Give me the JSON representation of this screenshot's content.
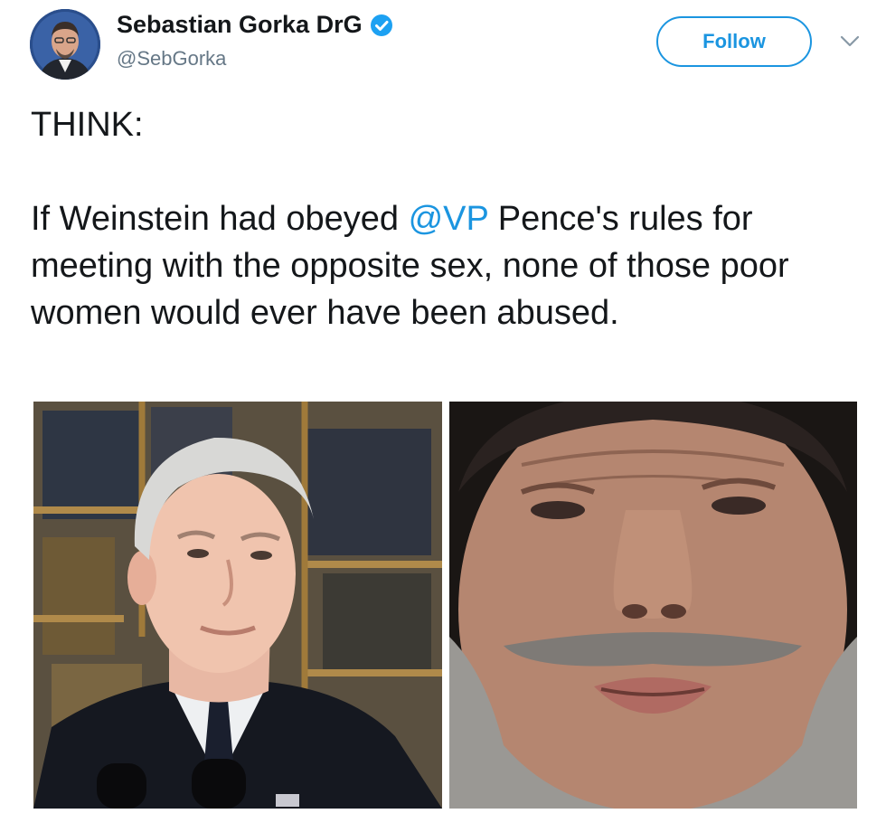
{
  "author": {
    "display_name": "Sebastian Gorka DrG",
    "handle": "@SebGorka",
    "verified": true,
    "avatar_icon": "profile-photo"
  },
  "actions": {
    "follow_label": "Follow",
    "menu_icon": "chevron-down-icon"
  },
  "tweet": {
    "line1": "THINK:",
    "p2_before": "If Weinstein had obeyed ",
    "mention": "@VP",
    "p2_after": " Pence's rules for meeting with the opposite sex, none of those poor women would ever have been abused."
  },
  "media": {
    "left_photo": "photo of Mike Pence",
    "right_photo": "photo of Harvey Weinstein"
  },
  "colors": {
    "link": "#1b95e0",
    "text": "#14171a",
    "secondary": "#657786"
  }
}
